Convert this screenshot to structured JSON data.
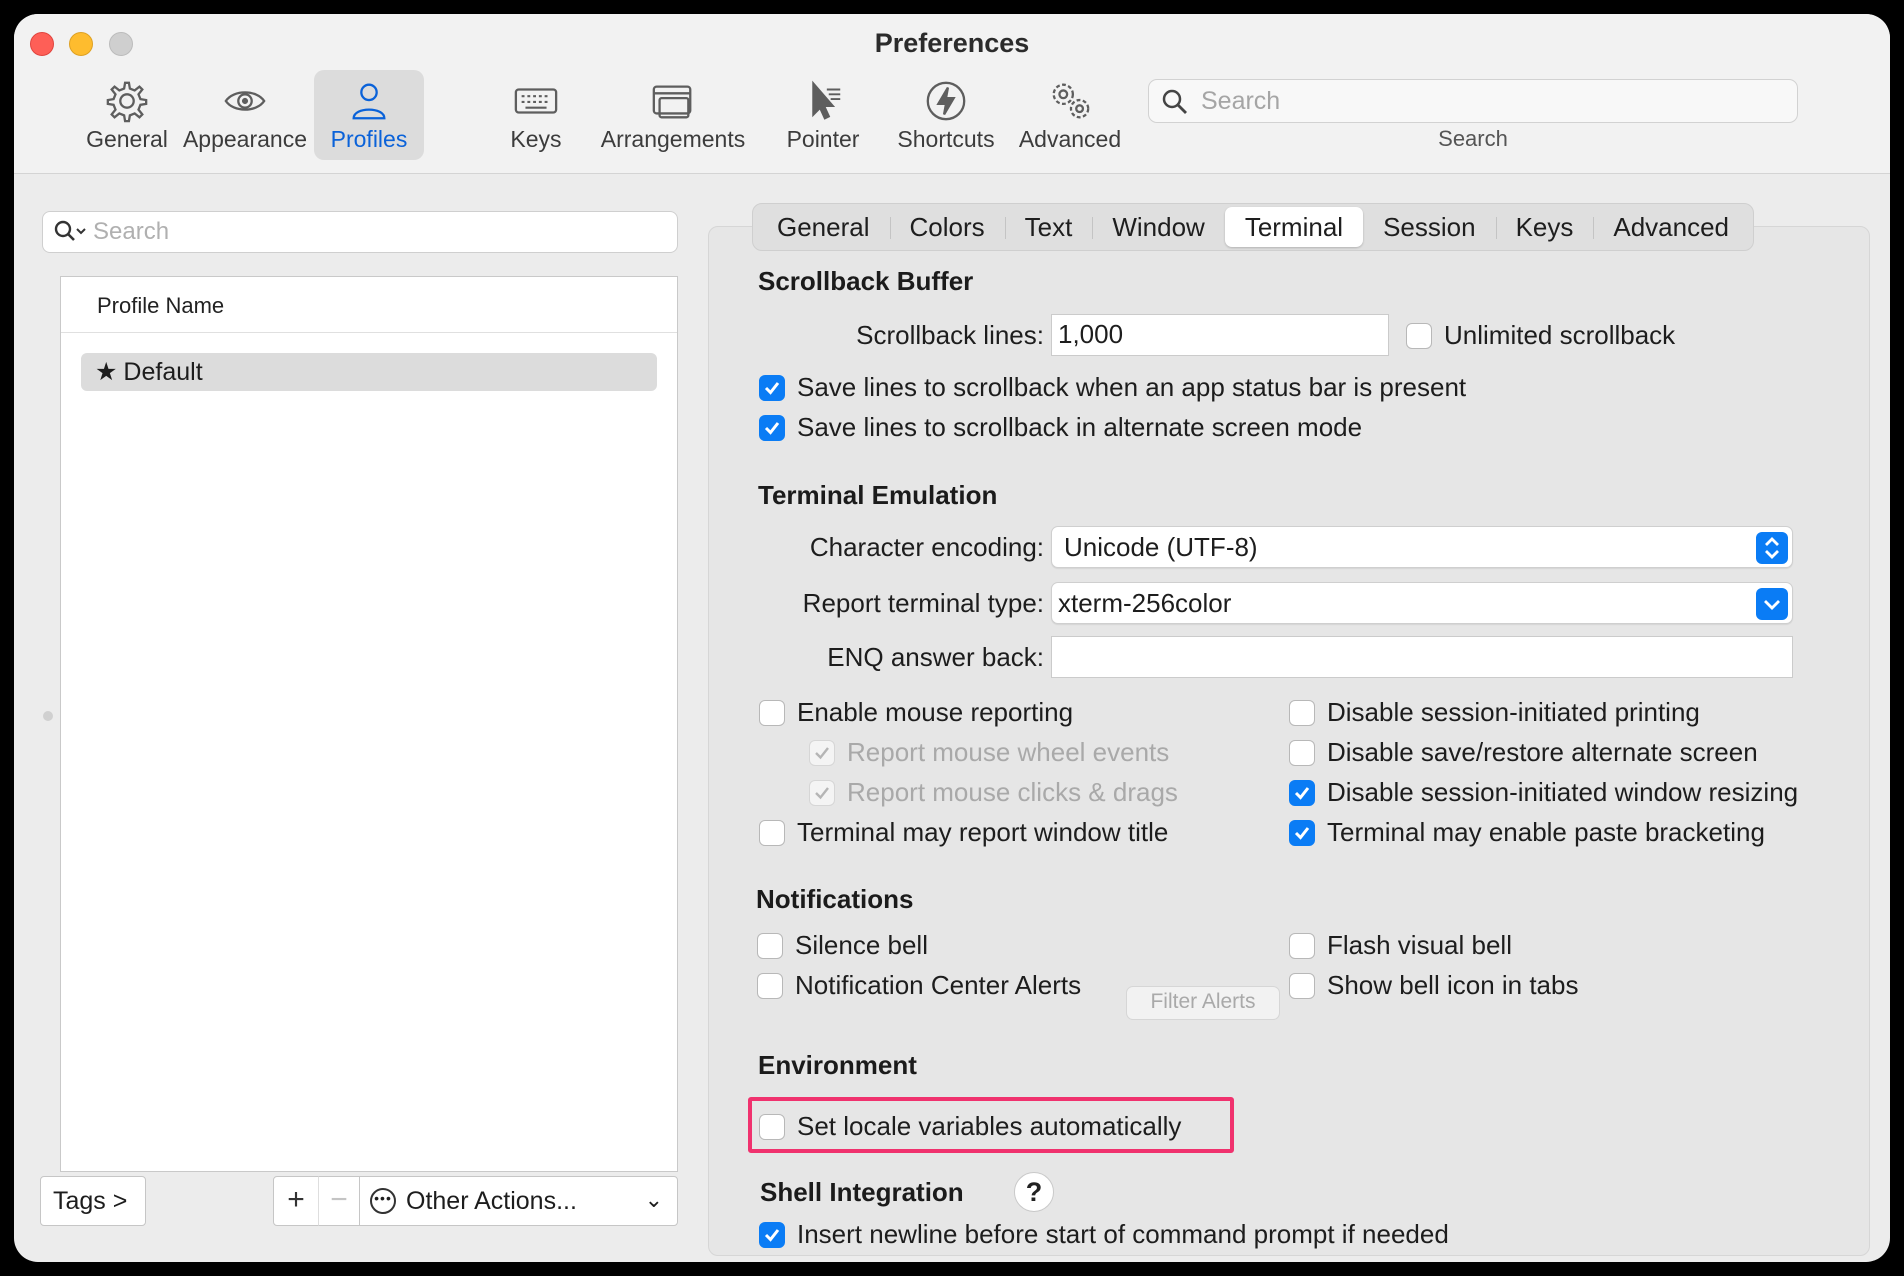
{
  "window": {
    "title": "Preferences"
  },
  "toolbar": {
    "items": [
      {
        "label": "General",
        "icon": "gear-icon"
      },
      {
        "label": "Appearance",
        "icon": "eye-icon"
      },
      {
        "label": "Profiles",
        "icon": "person-icon",
        "active": true
      },
      {
        "label": "Keys",
        "icon": "keyboard-icon"
      },
      {
        "label": "Arrangements",
        "icon": "windows-icon"
      },
      {
        "label": "Pointer",
        "icon": "cursor-icon"
      },
      {
        "label": "Shortcuts",
        "icon": "lightning-icon"
      },
      {
        "label": "Advanced",
        "icon": "gears-icon"
      }
    ],
    "search_placeholder": "Search",
    "search_label": "Search"
  },
  "profiles": {
    "search_placeholder": "Search",
    "column_header": "Profile Name",
    "rows": [
      {
        "name": "Default",
        "is_default": true
      }
    ],
    "tags_button": "Tags >",
    "add_button": "+",
    "remove_button": "−",
    "other_actions": "Other Actions...",
    "other_actions_chevron": "⌄"
  },
  "tabs": [
    "General",
    "Colors",
    "Text",
    "Window",
    "Terminal",
    "Session",
    "Keys",
    "Advanced"
  ],
  "active_tab": "Terminal",
  "scrollback": {
    "heading": "Scrollback Buffer",
    "lines_label": "Scrollback lines:",
    "lines_value": "1,000",
    "unlimited": "Unlimited scrollback",
    "save_status_bar": "Save lines to scrollback when an app status bar is present",
    "save_alternate": "Save lines to scrollback in alternate screen mode"
  },
  "emulation": {
    "heading": "Terminal Emulation",
    "encoding_label": "Character encoding:",
    "encoding_value": "Unicode (UTF-8)",
    "term_type_label": "Report terminal type:",
    "term_type_value": "xterm-256color",
    "enq_label": "ENQ answer back:",
    "enq_value": "",
    "mouse_reporting": "Enable mouse reporting",
    "mouse_wheel": "Report mouse wheel events",
    "mouse_clicks": "Report mouse clicks & drags",
    "window_title": "Terminal may report window title",
    "disable_printing": "Disable session-initiated printing",
    "disable_alt_screen": "Disable save/restore alternate screen",
    "disable_resizing": "Disable session-initiated window resizing",
    "paste_bracketing": "Terminal may enable paste bracketing"
  },
  "notifications": {
    "heading": "Notifications",
    "silence_bell": "Silence bell",
    "nc_alerts": "Notification Center Alerts",
    "filter_alerts": "Filter Alerts",
    "flash_bell": "Flash visual bell",
    "bell_icon": "Show bell icon in tabs"
  },
  "environment": {
    "heading": "Environment",
    "locale": "Set locale variables automatically"
  },
  "shell": {
    "heading": "Shell Integration",
    "help": "?",
    "newline": "Insert newline before start of command prompt if needed"
  },
  "colors": {
    "accent": "#0a7cf5",
    "highlight": "#f0326e"
  }
}
